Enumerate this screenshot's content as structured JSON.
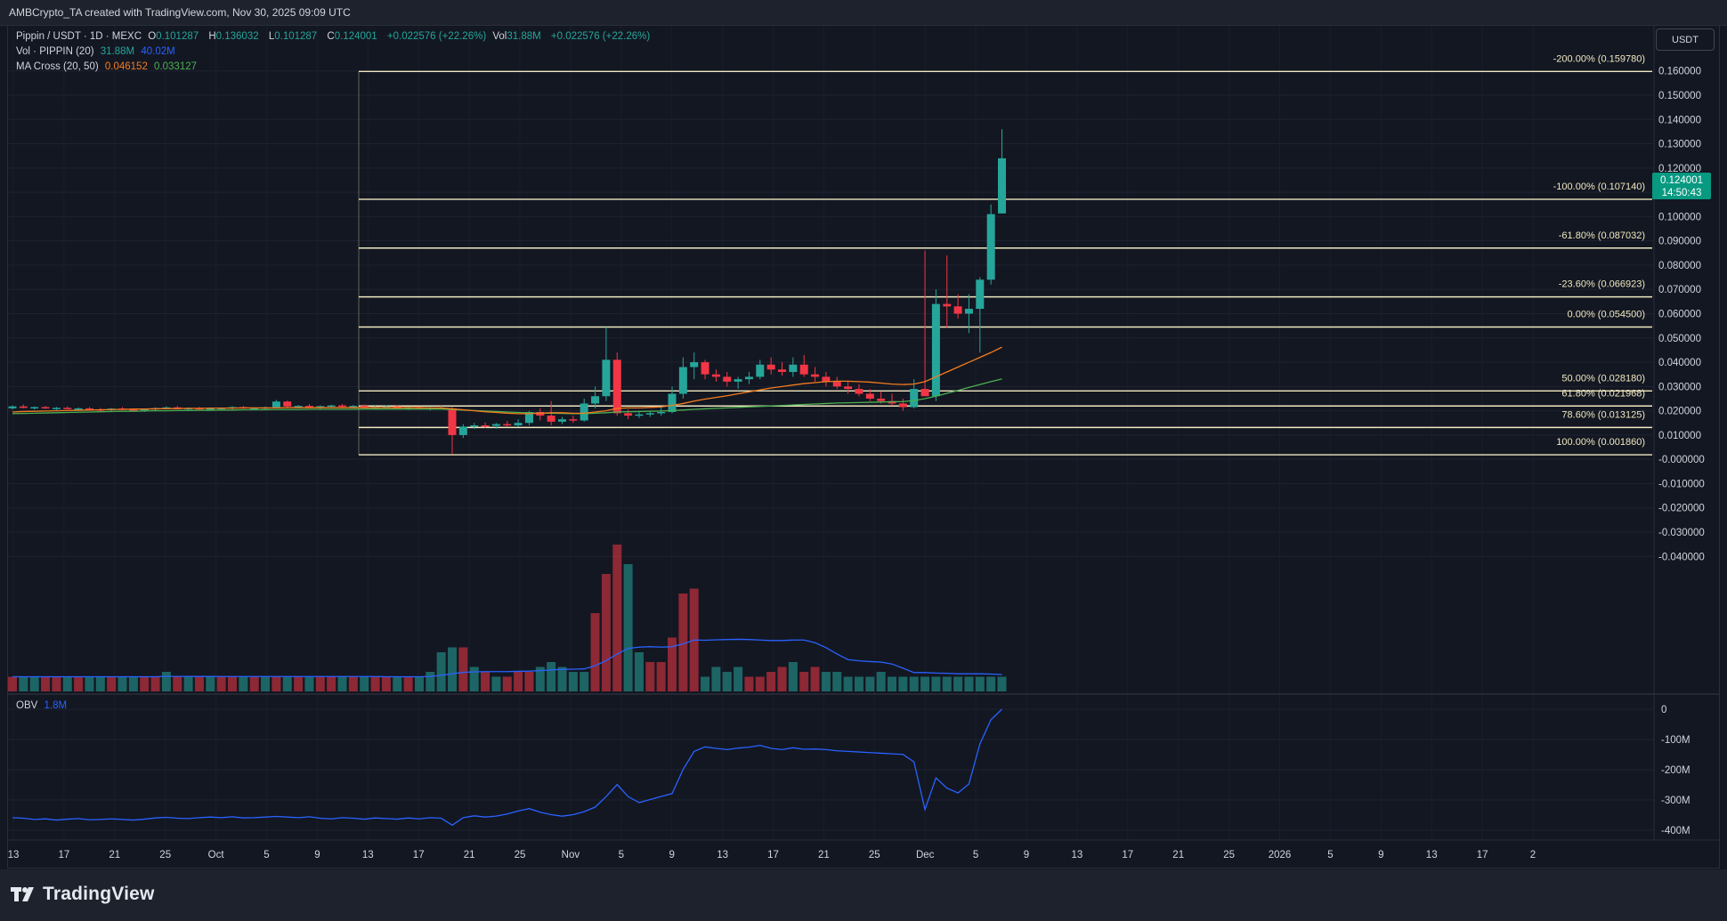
{
  "header": {
    "credit": "AMBCrypto_TA created with TradingView.com, Nov 30, 2025 09:09 UTC"
  },
  "footer": {
    "logo_text": "TradingView"
  },
  "legend": {
    "symbol": "Pippin / USDT · 1D · MEXC",
    "o_label": "O",
    "o_value": "0.101287",
    "h_label": "H",
    "h_value": "0.136032",
    "l_label": "L",
    "l_value": "0.101287",
    "c_label": "C",
    "c_value": "0.124001",
    "change": "+0.022576 (+22.26%)",
    "vol_label": "Vol",
    "vol_value": "31.88M",
    "vol_change": "+0.022576 (+22.26%)",
    "vol_indicator": "Vol · PIPPIN (20)",
    "vol_val1": "31.88M",
    "vol_val2": "40.02M",
    "ma_indicator": "MA Cross (20, 50)",
    "ma_val1": "0.046152",
    "ma_val2": "0.033127",
    "obv_label": "OBV",
    "obv_value": "1.8M"
  },
  "currency_button": "USDT",
  "price_tag": {
    "price": "0.124001",
    "countdown": "14:50:43"
  },
  "colors": {
    "up": "#26a69a",
    "down": "#f23645",
    "ma20": "#f57c1f",
    "ma50": "#4caf50",
    "vol_ma": "#2962ff",
    "obv": "#2962ff",
    "fib": "#f0e9c0",
    "tag": "#089981"
  },
  "chart_data": {
    "type": "candlestick",
    "price_axis_ticks": [
      "0.160000",
      "0.150000",
      "0.140000",
      "0.130000",
      "0.120000",
      "0.110000",
      "0.100000",
      "0.090000",
      "0.080000",
      "0.070000",
      "0.060000",
      "0.050000",
      "0.040000",
      "0.030000",
      "0.020000",
      "0.010000",
      "-0.000000",
      "-0.010000",
      "-0.020000",
      "-0.030000",
      "-0.040000"
    ],
    "obv_axis_ticks": [
      "0",
      "-100M",
      "-200M",
      "-300M",
      "-400M"
    ],
    "x_axis_ticks": [
      "13",
      "17",
      "21",
      "25",
      "Oct",
      "5",
      "9",
      "13",
      "17",
      "21",
      "25",
      "Nov",
      "5",
      "9",
      "13",
      "17",
      "21",
      "25",
      "Dec",
      "5",
      "9",
      "13",
      "17",
      "21",
      "25",
      "2026",
      "5",
      "9",
      "13",
      "17",
      "2"
    ],
    "fib_levels": [
      {
        "label": "-200.00% (0.159780)",
        "price": 0.15978
      },
      {
        "label": "-100.00% (0.107140)",
        "price": 0.10714
      },
      {
        "label": "-61.80% (0.087032)",
        "price": 0.087032
      },
      {
        "label": "-23.60% (0.066923)",
        "price": 0.066923
      },
      {
        "label": "0.00% (0.054500)",
        "price": 0.0545
      },
      {
        "label": "50.00% (0.028180)",
        "price": 0.02818
      },
      {
        "label": "61.80% (0.021968)",
        "price": 0.021968
      },
      {
        "label": "78.60% (0.013125)",
        "price": 0.013125
      },
      {
        "label": "100.00% (0.001860)",
        "price": 0.00186
      }
    ],
    "candles": [
      [
        0.021,
        0.0222,
        0.0205,
        0.0218
      ],
      [
        0.0218,
        0.0226,
        0.021,
        0.0212
      ],
      [
        0.0212,
        0.0218,
        0.0205,
        0.0215
      ],
      [
        0.0215,
        0.022,
        0.0208,
        0.021
      ],
      [
        0.021,
        0.0216,
        0.0203,
        0.0212
      ],
      [
        0.0212,
        0.0218,
        0.0206,
        0.0208
      ],
      [
        0.0208,
        0.0214,
        0.02,
        0.021
      ],
      [
        0.021,
        0.0215,
        0.0203,
        0.0206
      ],
      [
        0.0206,
        0.0212,
        0.0198,
        0.0204
      ],
      [
        0.0204,
        0.0211,
        0.0198,
        0.0209
      ],
      [
        0.0209,
        0.0215,
        0.0203,
        0.0206
      ],
      [
        0.0206,
        0.021,
        0.0198,
        0.0202
      ],
      [
        0.0202,
        0.0209,
        0.0195,
        0.0207
      ],
      [
        0.0207,
        0.0214,
        0.02,
        0.0211
      ],
      [
        0.0211,
        0.0218,
        0.0205,
        0.0214
      ],
      [
        0.0214,
        0.022,
        0.0207,
        0.0209
      ],
      [
        0.0209,
        0.0214,
        0.0202,
        0.0211
      ],
      [
        0.0211,
        0.0216,
        0.0205,
        0.0208
      ],
      [
        0.0208,
        0.0213,
        0.0201,
        0.021
      ],
      [
        0.021,
        0.0214,
        0.0204,
        0.0212
      ],
      [
        0.0212,
        0.0219,
        0.0206,
        0.0215
      ],
      [
        0.0215,
        0.022,
        0.0208,
        0.021
      ],
      [
        0.021,
        0.0214,
        0.0203,
        0.0212
      ],
      [
        0.0212,
        0.0218,
        0.0206,
        0.0214
      ],
      [
        0.0214,
        0.0245,
        0.021,
        0.0238
      ],
      [
        0.0238,
        0.0242,
        0.0212,
        0.0218
      ],
      [
        0.0218,
        0.0224,
        0.021,
        0.022
      ],
      [
        0.022,
        0.0228,
        0.0214,
        0.0216
      ],
      [
        0.0216,
        0.0222,
        0.0208,
        0.0219
      ],
      [
        0.0219,
        0.0225,
        0.0212,
        0.0222
      ],
      [
        0.0222,
        0.0228,
        0.0215,
        0.0217
      ],
      [
        0.0217,
        0.0224,
        0.021,
        0.022
      ],
      [
        0.022,
        0.0226,
        0.0212,
        0.0214
      ],
      [
        0.0214,
        0.022,
        0.0208,
        0.0216
      ],
      [
        0.0216,
        0.0222,
        0.021,
        0.0218
      ],
      [
        0.0218,
        0.0224,
        0.0212,
        0.021
      ],
      [
        0.021,
        0.0216,
        0.0203,
        0.0212
      ],
      [
        0.0212,
        0.0218,
        0.0205,
        0.0208
      ],
      [
        0.0208,
        0.0216,
        0.0201,
        0.0213
      ],
      [
        0.0213,
        0.022,
        0.0206,
        0.0211
      ],
      [
        0.021,
        0.0215,
        0.002,
        0.01
      ],
      [
        0.01,
        0.0145,
        0.0088,
        0.0135
      ],
      [
        0.0135,
        0.015,
        0.0125,
        0.014
      ],
      [
        0.014,
        0.0152,
        0.0128,
        0.0138
      ],
      [
        0.0138,
        0.015,
        0.0126,
        0.0145
      ],
      [
        0.0145,
        0.0158,
        0.0132,
        0.014
      ],
      [
        0.014,
        0.0165,
        0.0135,
        0.015
      ],
      [
        0.015,
        0.02,
        0.014,
        0.0195
      ],
      [
        0.0195,
        0.021,
        0.016,
        0.018
      ],
      [
        0.018,
        0.024,
        0.014,
        0.0155
      ],
      [
        0.0155,
        0.0175,
        0.0145,
        0.0165
      ],
      [
        0.0165,
        0.018,
        0.015,
        0.016
      ],
      [
        0.016,
        0.025,
        0.0155,
        0.023
      ],
      [
        0.023,
        0.03,
        0.021,
        0.026
      ],
      [
        0.026,
        0.0545,
        0.024,
        0.041
      ],
      [
        0.041,
        0.044,
        0.018,
        0.019
      ],
      [
        0.019,
        0.0205,
        0.0165,
        0.018
      ],
      [
        0.018,
        0.02,
        0.017,
        0.0185
      ],
      [
        0.0185,
        0.0198,
        0.0175,
        0.019
      ],
      [
        0.019,
        0.0215,
        0.018,
        0.0195
      ],
      [
        0.0195,
        0.03,
        0.019,
        0.027
      ],
      [
        0.027,
        0.042,
        0.025,
        0.038
      ],
      [
        0.038,
        0.044,
        0.033,
        0.04
      ],
      [
        0.04,
        0.041,
        0.033,
        0.035
      ],
      [
        0.035,
        0.037,
        0.032,
        0.034
      ],
      [
        0.034,
        0.036,
        0.03,
        0.032
      ],
      [
        0.032,
        0.034,
        0.029,
        0.033
      ],
      [
        0.033,
        0.036,
        0.031,
        0.034
      ],
      [
        0.034,
        0.041,
        0.033,
        0.039
      ],
      [
        0.039,
        0.042,
        0.035,
        0.037
      ],
      [
        0.037,
        0.04,
        0.0345,
        0.036
      ],
      [
        0.036,
        0.042,
        0.034,
        0.039
      ],
      [
        0.039,
        0.043,
        0.034,
        0.035
      ],
      [
        0.035,
        0.038,
        0.032,
        0.034
      ],
      [
        0.034,
        0.036,
        0.03,
        0.032
      ],
      [
        0.032,
        0.034,
        0.029,
        0.03
      ],
      [
        0.03,
        0.032,
        0.027,
        0.029
      ],
      [
        0.029,
        0.031,
        0.026,
        0.027
      ],
      [
        0.027,
        0.029,
        0.024,
        0.025
      ],
      [
        0.025,
        0.028,
        0.023,
        0.024
      ],
      [
        0.024,
        0.027,
        0.022,
        0.023
      ],
      [
        0.023,
        0.025,
        0.02,
        0.0215
      ],
      [
        0.0215,
        0.033,
        0.021,
        0.029
      ],
      [
        0.029,
        0.086,
        0.027,
        0.026
      ],
      [
        0.026,
        0.07,
        0.024,
        0.064
      ],
      [
        0.064,
        0.084,
        0.054,
        0.063
      ],
      [
        0.063,
        0.068,
        0.058,
        0.06
      ],
      [
        0.06,
        0.068,
        0.052,
        0.062
      ],
      [
        0.062,
        0.075,
        0.044,
        0.074
      ],
      [
        0.074,
        0.105,
        0.072,
        0.101
      ],
      [
        0.1013,
        0.136,
        0.1013,
        0.124
      ]
    ],
    "volume": [
      [
        3,
        0
      ],
      [
        3,
        1
      ],
      [
        3,
        1
      ],
      [
        3,
        0
      ],
      [
        3,
        0
      ],
      [
        3,
        1
      ],
      [
        3,
        0
      ],
      [
        3,
        1
      ],
      [
        3,
        1
      ],
      [
        3,
        0
      ],
      [
        3,
        1
      ],
      [
        3,
        1
      ],
      [
        3,
        0
      ],
      [
        3,
        0
      ],
      [
        4,
        1
      ],
      [
        3,
        0
      ],
      [
        3,
        1
      ],
      [
        3,
        0
      ],
      [
        3,
        1
      ],
      [
        3,
        0
      ],
      [
        3,
        0
      ],
      [
        3,
        1
      ],
      [
        3,
        0
      ],
      [
        3,
        1
      ],
      [
        3,
        0
      ],
      [
        3,
        1
      ],
      [
        3,
        0
      ],
      [
        3,
        1
      ],
      [
        3,
        0
      ],
      [
        3,
        0
      ],
      [
        3,
        1
      ],
      [
        3,
        0
      ],
      [
        3,
        1
      ],
      [
        3,
        0
      ],
      [
        3,
        0
      ],
      [
        3,
        1
      ],
      [
        3,
        0
      ],
      [
        3,
        1
      ],
      [
        4,
        1
      ],
      [
        8,
        1
      ],
      [
        9,
        1
      ],
      [
        9,
        0
      ],
      [
        5,
        1
      ],
      [
        4,
        0
      ],
      [
        3,
        1
      ],
      [
        3,
        0
      ],
      [
        4,
        0
      ],
      [
        4,
        0
      ],
      [
        5,
        1
      ],
      [
        6,
        1
      ],
      [
        5,
        1
      ],
      [
        4,
        1
      ],
      [
        4,
        1
      ],
      [
        16,
        0
      ],
      [
        24,
        0
      ],
      [
        30,
        0
      ],
      [
        26,
        1
      ],
      [
        8,
        1
      ],
      [
        6,
        0
      ],
      [
        6,
        0
      ],
      [
        11,
        0
      ],
      [
        20,
        0
      ],
      [
        21,
        0
      ],
      [
        3,
        1
      ],
      [
        5,
        1
      ],
      [
        4,
        1
      ],
      [
        5,
        1
      ],
      [
        3,
        0
      ],
      [
        3,
        0
      ],
      [
        4,
        0
      ],
      [
        5,
        0
      ],
      [
        6,
        1
      ],
      [
        4,
        0
      ],
      [
        5,
        0
      ],
      [
        4,
        1
      ],
      [
        4,
        1
      ],
      [
        3,
        1
      ],
      [
        3,
        1
      ],
      [
        3,
        1
      ],
      [
        4,
        1
      ],
      [
        3,
        1
      ],
      [
        3,
        1
      ],
      [
        3,
        1
      ],
      [
        3,
        1
      ],
      [
        3,
        1
      ],
      [
        3,
        1
      ],
      [
        3,
        1
      ],
      [
        3,
        1
      ],
      [
        3,
        1
      ],
      [
        3,
        1
      ],
      [
        3,
        1
      ],
      [
        3,
        1
      ],
      [
        3,
        1
      ],
      [
        3,
        1
      ],
      [
        3,
        1
      ],
      [
        3,
        1
      ],
      [
        3,
        1
      ],
      [
        3,
        1
      ],
      [
        3,
        1
      ],
      [
        3,
        1
      ],
      [
        3,
        1
      ],
      [
        3,
        1
      ],
      [
        3,
        1
      ],
      [
        3,
        1
      ],
      [
        3,
        1
      ],
      [
        3,
        1
      ],
      [
        3,
        1
      ],
      [
        3,
        1
      ],
      [
        3,
        1
      ],
      [
        3,
        1
      ]
    ],
    "obv": [
      -360,
      -362,
      -366,
      -364,
      -368,
      -365,
      -363,
      -367,
      -366,
      -364,
      -366,
      -368,
      -365,
      -361,
      -359,
      -362,
      -363,
      -360,
      -358,
      -360,
      -357,
      -361,
      -360,
      -358,
      -356,
      -358,
      -360,
      -357,
      -362,
      -364,
      -360,
      -362,
      -365,
      -361,
      -363,
      -365,
      -361,
      -364,
      -360,
      -362,
      -385,
      -360,
      -354,
      -358,
      -355,
      -348,
      -338,
      -330,
      -342,
      -350,
      -355,
      -350,
      -340,
      -325,
      -290,
      -250,
      -290,
      -310,
      -300,
      -290,
      -280,
      -200,
      -140,
      -125,
      -130,
      -134,
      -129,
      -126,
      -120,
      -130,
      -134,
      -128,
      -133,
      -132,
      -134,
      -138,
      -140,
      -142,
      -144,
      -146,
      -148,
      -150,
      -175,
      -333,
      -228,
      -262,
      -278,
      -248,
      -115,
      -35,
      0
    ],
    "ma20": [
      0.0195,
      0.0197,
      0.0198,
      0.0199,
      0.02,
      0.0201,
      0.0202,
      0.0203,
      0.0204,
      0.0205,
      0.0206,
      0.0207,
      0.0207,
      0.0208,
      0.0209,
      0.0209,
      0.021,
      0.021,
      0.0211,
      0.0211,
      0.0211,
      0.0212,
      0.0212,
      0.0212,
      0.0212,
      0.0213,
      0.0213,
      0.0213,
      0.0213,
      0.0213,
      0.0213,
      0.0213,
      0.0213,
      0.0213,
      0.0213,
      0.0213,
      0.0213,
      0.0213,
      0.0212,
      0.0212,
      0.0208,
      0.0204,
      0.02,
      0.0196,
      0.0193,
      0.019,
      0.0188,
      0.0188,
      0.019,
      0.0192,
      0.0192,
      0.019,
      0.019,
      0.0195,
      0.02,
      0.021,
      0.0212,
      0.0212,
      0.0214,
      0.0216,
      0.0222,
      0.023,
      0.024,
      0.0248,
      0.0255,
      0.0262,
      0.027,
      0.0278,
      0.0286,
      0.0294,
      0.03,
      0.0306,
      0.0312,
      0.0316,
      0.032,
      0.0322,
      0.0322,
      0.032,
      0.0318,
      0.0314,
      0.031,
      0.0308,
      0.031,
      0.032,
      0.034,
      0.036,
      0.038,
      0.04,
      0.042,
      0.044,
      0.0462
    ],
    "ma50": [
      0.0188,
      0.0189,
      0.019,
      0.0191,
      0.0192,
      0.0193,
      0.0194,
      0.0195,
      0.0196,
      0.0197,
      0.0198,
      0.0198,
      0.0199,
      0.02,
      0.02,
      0.0201,
      0.0201,
      0.0202,
      0.0202,
      0.0203,
      0.0203,
      0.0204,
      0.0204,
      0.0204,
      0.0205,
      0.0205,
      0.0205,
      0.0206,
      0.0206,
      0.0206,
      0.0206,
      0.0206,
      0.0207,
      0.0207,
      0.0207,
      0.0207,
      0.0207,
      0.0207,
      0.0207,
      0.0207,
      0.0205,
      0.0203,
      0.0201,
      0.0199,
      0.0197,
      0.0195,
      0.0193,
      0.0191,
      0.019,
      0.019,
      0.0189,
      0.0188,
      0.0188,
      0.019,
      0.0192,
      0.0195,
      0.0196,
      0.0197,
      0.0198,
      0.0199,
      0.0201,
      0.0203,
      0.0206,
      0.0208,
      0.021,
      0.0212,
      0.0214,
      0.0216,
      0.0218,
      0.022,
      0.0222,
      0.0224,
      0.0226,
      0.0228,
      0.023,
      0.0232,
      0.0233,
      0.0234,
      0.0235,
      0.0236,
      0.0237,
      0.0238,
      0.0242,
      0.025,
      0.026,
      0.0272,
      0.0284,
      0.0296,
      0.0308,
      0.032,
      0.0331
    ]
  }
}
